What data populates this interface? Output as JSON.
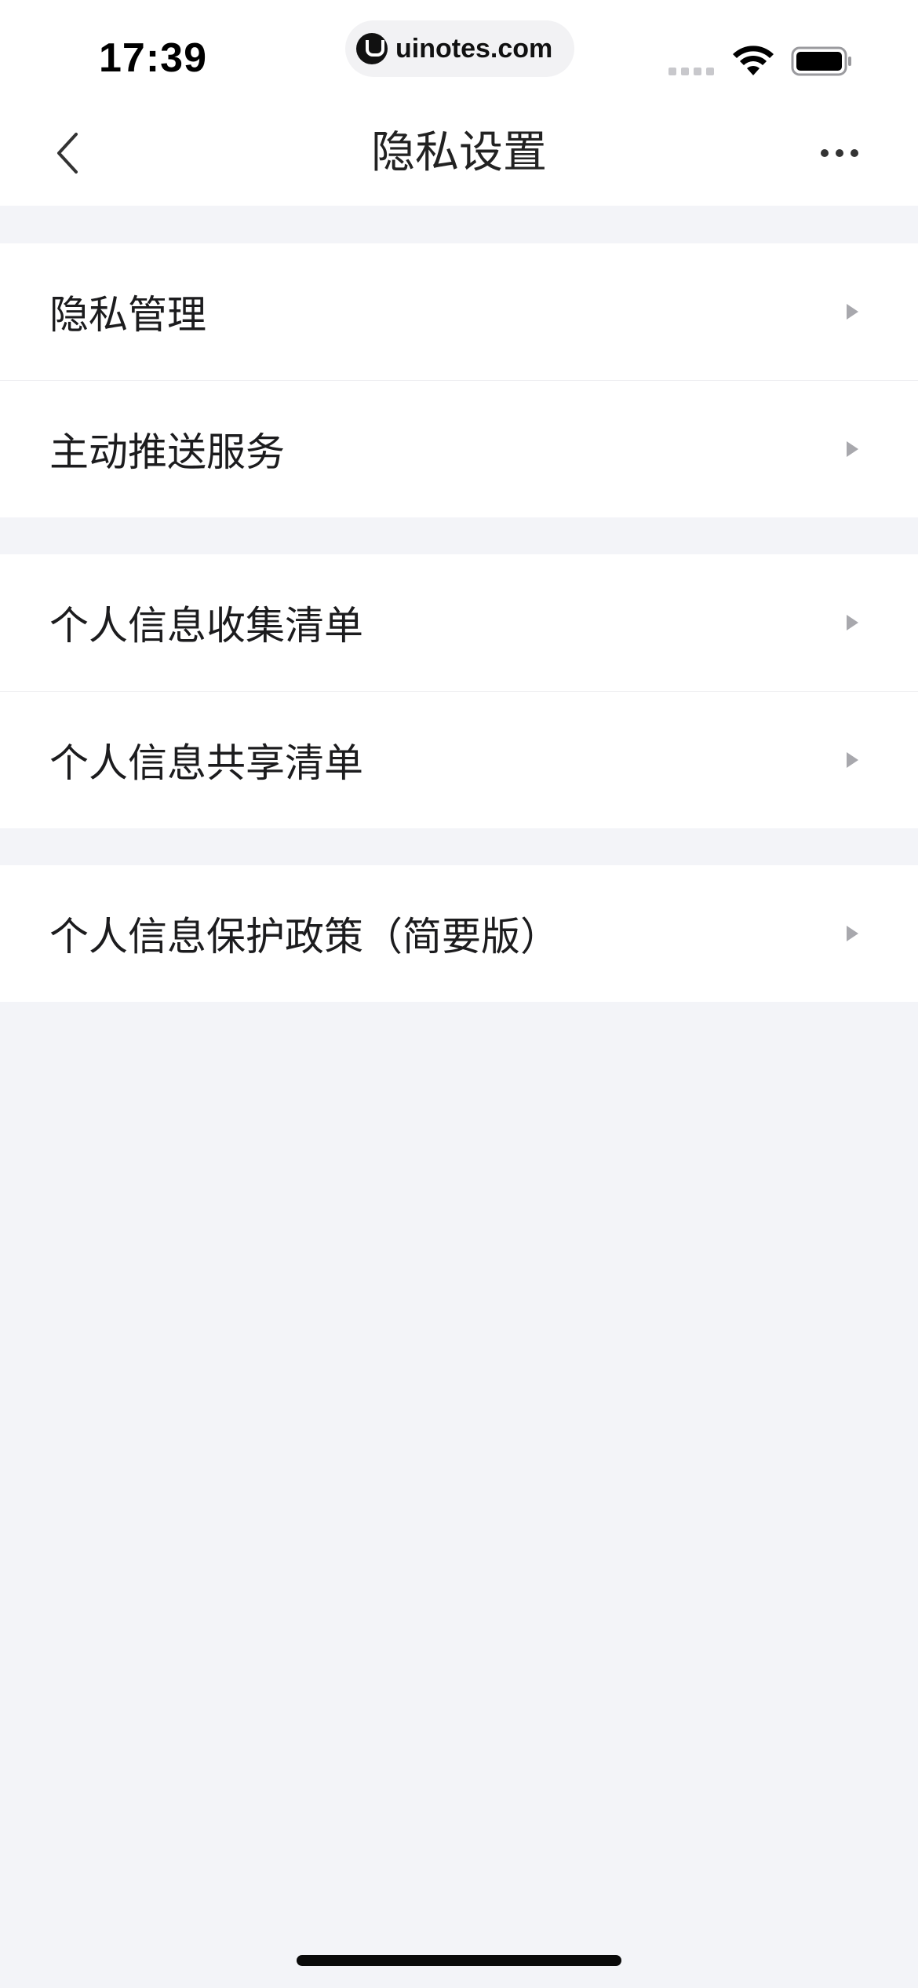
{
  "status_bar": {
    "time": "17:39",
    "url": "uinotes.com",
    "icons": [
      "signal-icon",
      "wifi-icon",
      "battery-icon"
    ]
  },
  "nav": {
    "title": "隐私设置",
    "back_icon": "chevron-left-icon",
    "more_icon": "more-dots-icon"
  },
  "groups": [
    {
      "items": [
        {
          "label": "隐私管理"
        },
        {
          "label": "主动推送服务"
        }
      ]
    },
    {
      "items": [
        {
          "label": "个人信息收集清单"
        },
        {
          "label": "个人信息共享清单"
        }
      ]
    },
    {
      "items": [
        {
          "label": "个人信息保护政策（简要版）"
        }
      ]
    }
  ],
  "colors": {
    "page_background": "#f3f4f8",
    "surface": "#ffffff",
    "chevron": "#a8a8ad",
    "text_primary": "#1c1c1e"
  }
}
